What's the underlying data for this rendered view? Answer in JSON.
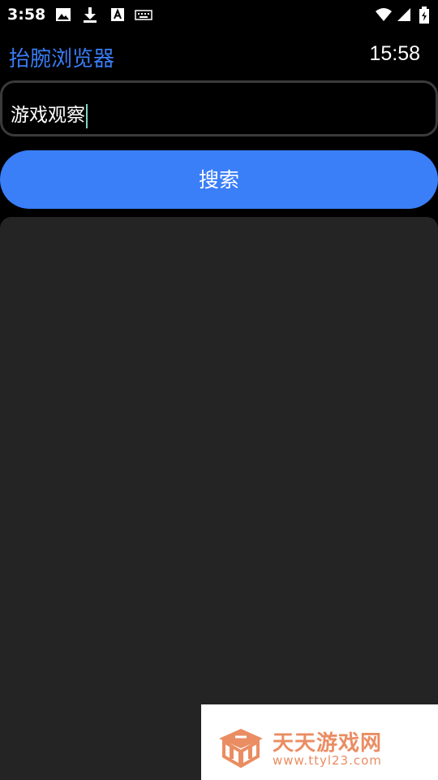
{
  "status_bar": {
    "time": "3:58",
    "icons": [
      "image-icon",
      "download-icon",
      "font-a-icon",
      "keyboard-icon",
      "wifi-icon",
      "signal-icon",
      "battery-icon"
    ]
  },
  "app": {
    "title": "抬腕浏览器",
    "clock": "15:58"
  },
  "search": {
    "value": "游戏观察",
    "button_label": "搜索"
  },
  "watermark": {
    "name": "天天游戏网",
    "url": "www.ttyl23.com"
  },
  "colors": {
    "accent": "#3a7ef8",
    "title": "#3a7bf2",
    "panel": "#242424",
    "watermark": "#ea8d62"
  }
}
